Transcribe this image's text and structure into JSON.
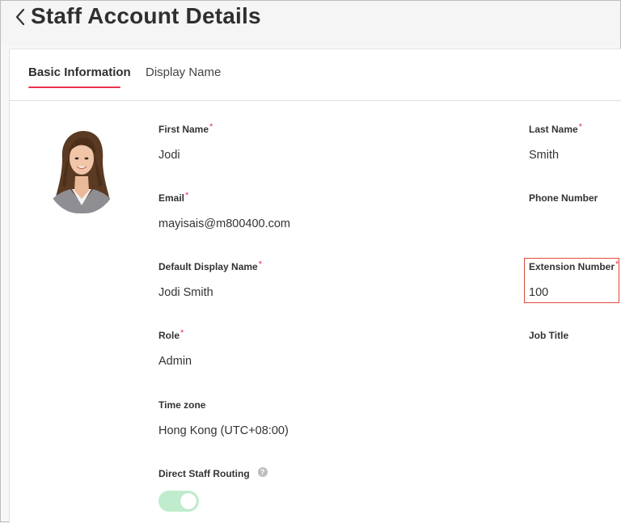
{
  "header": {
    "title": "Staff Account Details"
  },
  "tabs": [
    {
      "label": "Basic Information",
      "active": true
    },
    {
      "label": "Display Name",
      "active": false
    }
  ],
  "colors": {
    "accent": "#e8344c",
    "highlight": "#e04a3a",
    "toggle_on": "#bfeccc"
  },
  "fields": {
    "first_name": {
      "label": "First Name",
      "required": "*",
      "value": "Jodi"
    },
    "last_name": {
      "label": "Last Name",
      "required": "*",
      "value": "Smith"
    },
    "email": {
      "label": "Email",
      "required": "*",
      "value": "mayisais@m800400.com"
    },
    "phone_number": {
      "label": "Phone Number",
      "value": ""
    },
    "default_display_name": {
      "label": "Default Display Name",
      "required": "*",
      "value": "Jodi Smith"
    },
    "extension_number": {
      "label": "Extension Number",
      "required": "*",
      "value": "100"
    },
    "role": {
      "label": "Role",
      "required": "*",
      "value": "Admin"
    },
    "job_title": {
      "label": "Job Title",
      "value": ""
    },
    "time_zone": {
      "label": "Time zone",
      "value": "Hong Kong (UTC+08:00)"
    },
    "direct_staff_routing": {
      "label": "Direct Staff Routing",
      "help": "?",
      "enabled": true
    }
  }
}
